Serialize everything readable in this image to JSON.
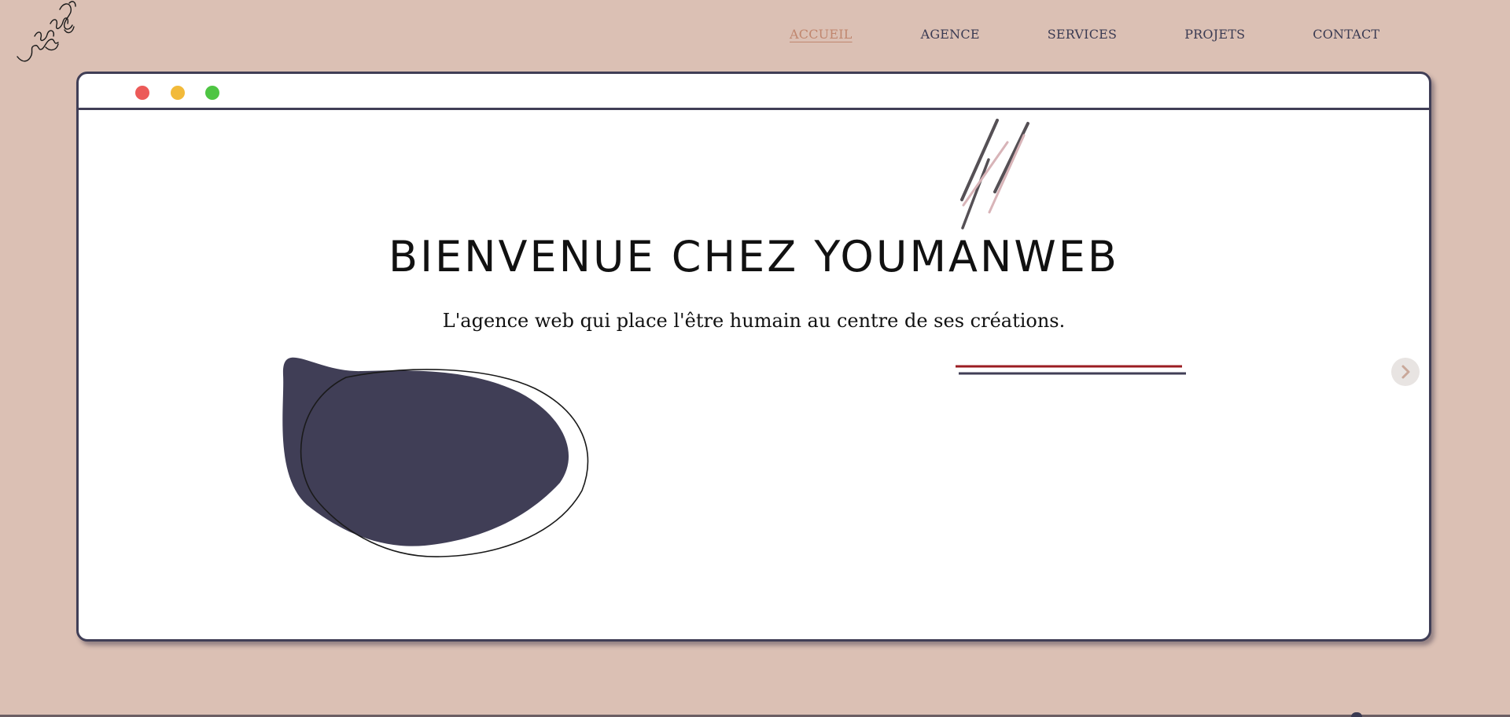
{
  "nav": {
    "items": [
      {
        "label": "ACCUEIL",
        "active": true
      },
      {
        "label": "AGENCE",
        "active": false
      },
      {
        "label": "SERVICES",
        "active": false
      },
      {
        "label": "PROJETS",
        "active": false
      },
      {
        "label": "CONTACT",
        "active": false
      }
    ]
  },
  "hero": {
    "title": "BIENVENUE CHEZ YOUMANWEB",
    "subtitle": "L'agence web qui place l'être humain au centre de ses créations."
  },
  "window_controls": [
    "close-dot",
    "minimize-dot",
    "maximize-dot"
  ],
  "colors": {
    "background": "#dbc0b4",
    "nav_active": "#c0866e",
    "nav_text": "#3a3a52",
    "window_border": "#403e56",
    "blob": "#403e56",
    "accent_red": "#9b1c22",
    "dot_red": "#ec5a58",
    "dot_yellow": "#f2ba3a",
    "dot_green": "#4ec543"
  },
  "icons": {
    "logo": "handwritten-logo-icon",
    "next": "chevron-right-icon"
  }
}
